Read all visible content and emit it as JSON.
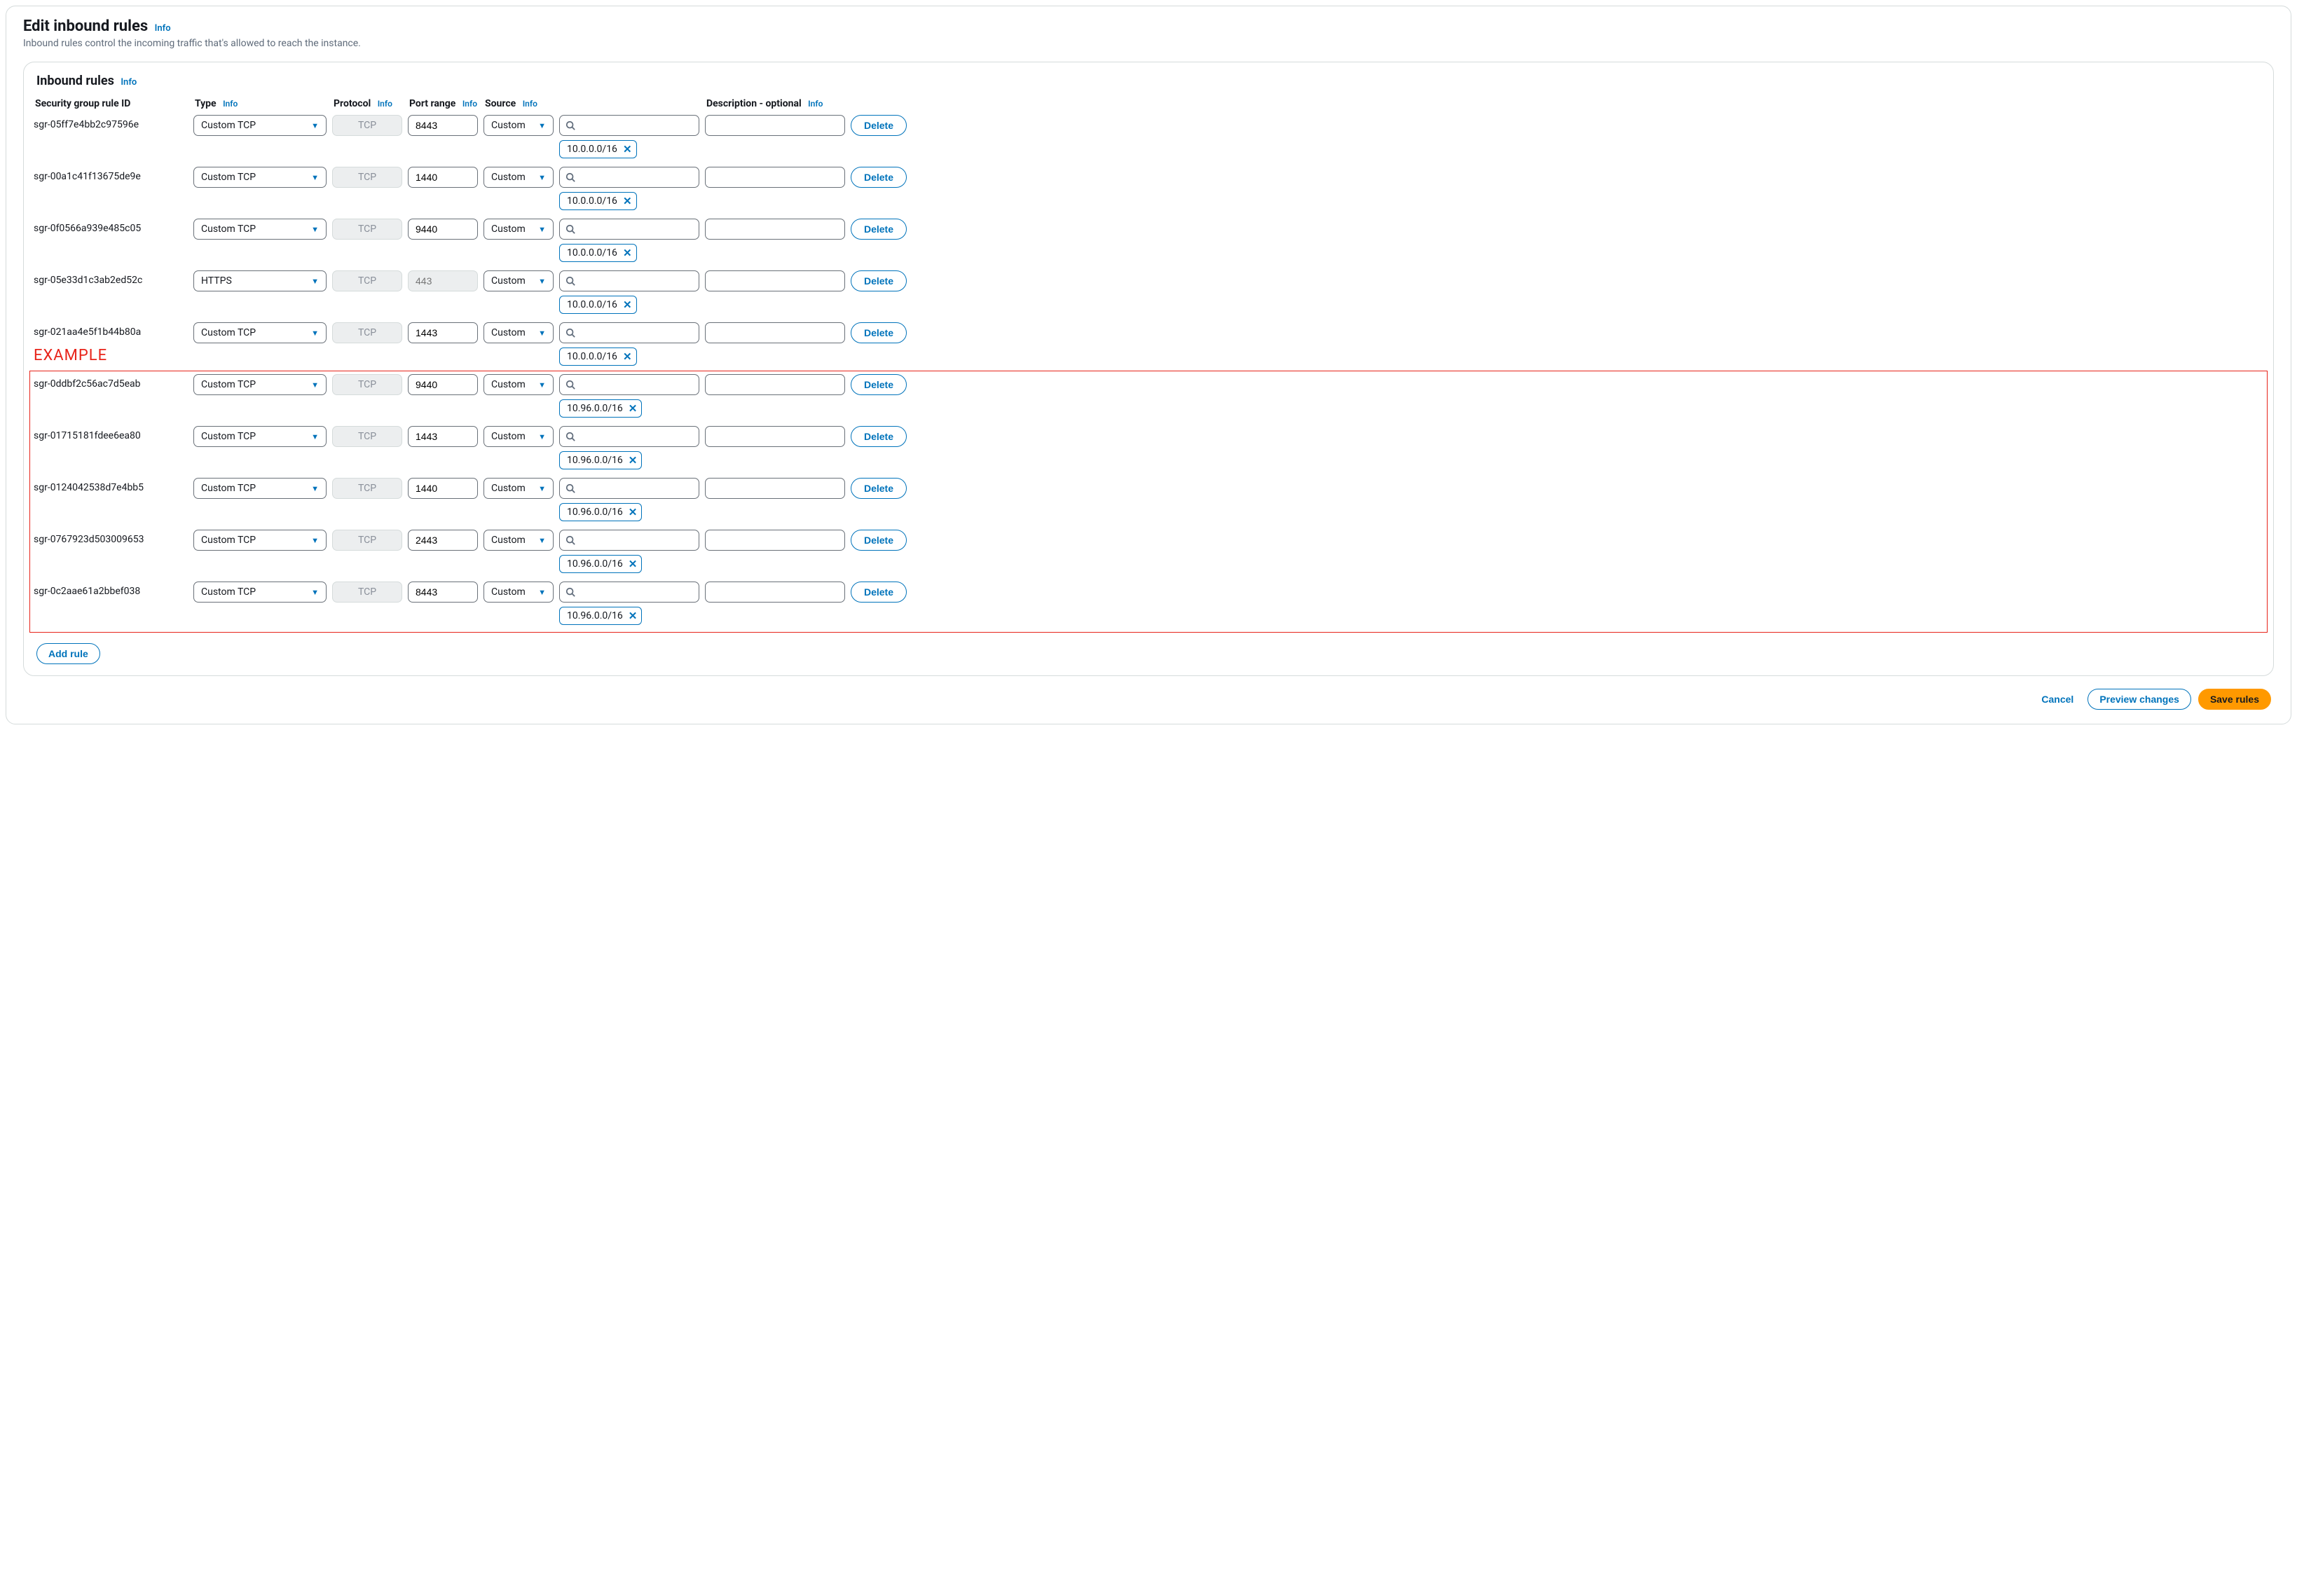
{
  "page": {
    "title": "Edit inbound rules",
    "info": "Info",
    "subtitle": "Inbound rules control the incoming traffic that's allowed to reach the instance."
  },
  "panel": {
    "title": "Inbound rules",
    "info": "Info"
  },
  "headers": {
    "id": "Security group rule ID",
    "type": "Type",
    "protocol": "Protocol",
    "port": "Port range",
    "source": "Source",
    "description": "Description - optional",
    "info": "Info"
  },
  "rules": [
    {
      "id": "sgr-05ff7e4bb2c97596e",
      "type": "Custom TCP",
      "protocol": "TCP",
      "port": "8443",
      "port_disabled": false,
      "source": "Custom",
      "chip": "10.0.0.0/16"
    },
    {
      "id": "sgr-00a1c41f13675de9e",
      "type": "Custom TCP",
      "protocol": "TCP",
      "port": "1440",
      "port_disabled": false,
      "source": "Custom",
      "chip": "10.0.0.0/16"
    },
    {
      "id": "sgr-0f0566a939e485c05",
      "type": "Custom TCP",
      "protocol": "TCP",
      "port": "9440",
      "port_disabled": false,
      "source": "Custom",
      "chip": "10.0.0.0/16"
    },
    {
      "id": "sgr-05e33d1c3ab2ed52c",
      "type": "HTTPS",
      "protocol": "TCP",
      "port": "443",
      "port_disabled": true,
      "source": "Custom",
      "chip": "10.0.0.0/16"
    },
    {
      "id": "sgr-021aa4e5f1b44b80a",
      "type": "Custom TCP",
      "protocol": "TCP",
      "port": "1443",
      "port_disabled": false,
      "source": "Custom",
      "chip": "10.0.0.0/16"
    },
    {
      "id": "sgr-0ddbf2c56ac7d5eab",
      "type": "Custom TCP",
      "protocol": "TCP",
      "port": "9440",
      "port_disabled": false,
      "source": "Custom",
      "chip": "10.96.0.0/16"
    },
    {
      "id": "sgr-01715181fdee6ea80",
      "type": "Custom TCP",
      "protocol": "TCP",
      "port": "1443",
      "port_disabled": false,
      "source": "Custom",
      "chip": "10.96.0.0/16"
    },
    {
      "id": "sgr-0124042538d7e4bb5",
      "type": "Custom TCP",
      "protocol": "TCP",
      "port": "1440",
      "port_disabled": false,
      "source": "Custom",
      "chip": "10.96.0.0/16"
    },
    {
      "id": "sgr-0767923d503009653",
      "type": "Custom TCP",
      "protocol": "TCP",
      "port": "2443",
      "port_disabled": false,
      "source": "Custom",
      "chip": "10.96.0.0/16"
    },
    {
      "id": "sgr-0c2aae61a2bbef038",
      "type": "Custom TCP",
      "protocol": "TCP",
      "port": "8443",
      "port_disabled": false,
      "source": "Custom",
      "chip": "10.96.0.0/16"
    }
  ],
  "buttons": {
    "delete": "Delete",
    "add_rule": "Add rule",
    "cancel": "Cancel",
    "preview": "Preview changes",
    "save": "Save rules"
  },
  "annotation": {
    "example": "EXAMPLE"
  }
}
